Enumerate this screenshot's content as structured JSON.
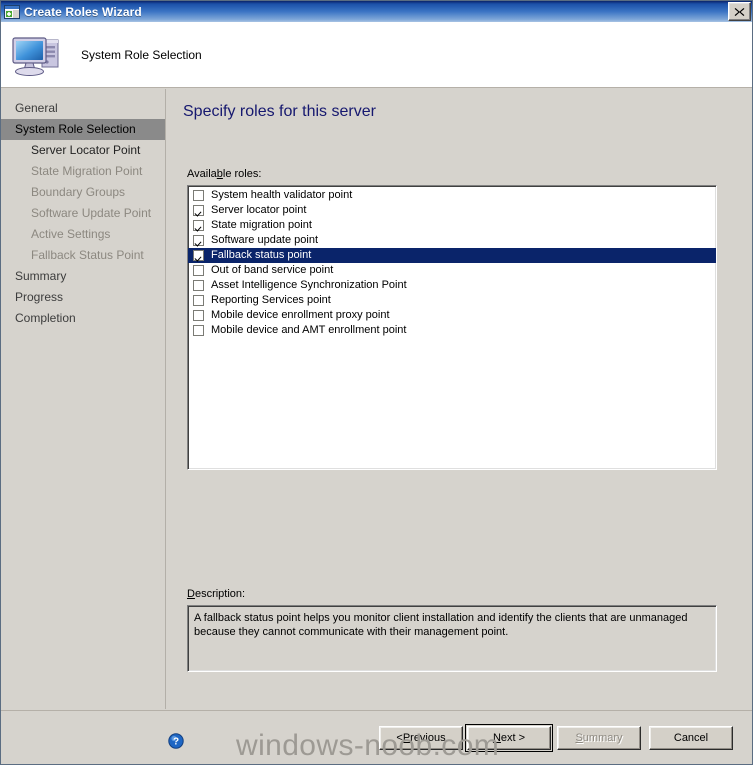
{
  "window": {
    "title": "Create Roles Wizard",
    "title_icon": "wizard-window-icon",
    "close_label": "✕"
  },
  "header": {
    "title": "System Role Selection",
    "icon": "computer-icon"
  },
  "sidebar": {
    "items": [
      {
        "label": "General",
        "level": "top",
        "state": "normal"
      },
      {
        "label": "System Role Selection",
        "level": "top",
        "state": "selected"
      },
      {
        "label": "Server Locator Point",
        "level": "sub",
        "state": "active"
      },
      {
        "label": "State Migration Point",
        "level": "sub",
        "state": "normal"
      },
      {
        "label": "Boundary Groups",
        "level": "sub",
        "state": "normal"
      },
      {
        "label": "Software Update Point",
        "level": "sub",
        "state": "normal"
      },
      {
        "label": "Active Settings",
        "level": "sub",
        "state": "normal"
      },
      {
        "label": "Fallback Status Point",
        "level": "sub",
        "state": "normal"
      },
      {
        "label": "Summary",
        "level": "top",
        "state": "normal"
      },
      {
        "label": "Progress",
        "level": "top",
        "state": "normal"
      },
      {
        "label": "Completion",
        "level": "top",
        "state": "normal"
      }
    ]
  },
  "main": {
    "page_title": "Specify roles for this server",
    "roles_label_pre": "Availa",
    "roles_label_acc": "b",
    "roles_label_post": "le roles:",
    "roles": [
      {
        "label": "System health validator point",
        "checked": false,
        "selected": false
      },
      {
        "label": "Server locator point",
        "checked": true,
        "selected": false
      },
      {
        "label": "State migration point",
        "checked": true,
        "selected": false
      },
      {
        "label": "Software update point",
        "checked": true,
        "selected": false
      },
      {
        "label": "Fallback status point",
        "checked": true,
        "selected": true
      },
      {
        "label": "Out of band service point",
        "checked": false,
        "selected": false
      },
      {
        "label": "Asset Intelligence Synchronization Point",
        "checked": false,
        "selected": false
      },
      {
        "label": "Reporting Services point",
        "checked": false,
        "selected": false
      },
      {
        "label": "Mobile device enrollment proxy point",
        "checked": false,
        "selected": false
      },
      {
        "label": "Mobile device and AMT enrollment point",
        "checked": false,
        "selected": false
      }
    ],
    "description_label_acc": "D",
    "description_label_post": "escription:",
    "description_text": "A fallback status point helps you monitor client installation and identify the clients that are unmanaged because they cannot communicate with their management point."
  },
  "buttons": {
    "help": "help-icon",
    "previous_pre": "< ",
    "previous_acc": "P",
    "previous_post": "revious",
    "next_pre": "",
    "next_acc": "N",
    "next_post": "ext >",
    "summary_acc": "S",
    "summary_post": "ummary",
    "cancel": "Cancel"
  },
  "watermark": "windows-noob.com",
  "colors": {
    "titlebar_blue": "#0a246a",
    "heading_navy": "#16186f",
    "selection_navy": "#0a246a",
    "face": "#d6d3cd",
    "sidebar_selected": "#8a8a8a"
  }
}
